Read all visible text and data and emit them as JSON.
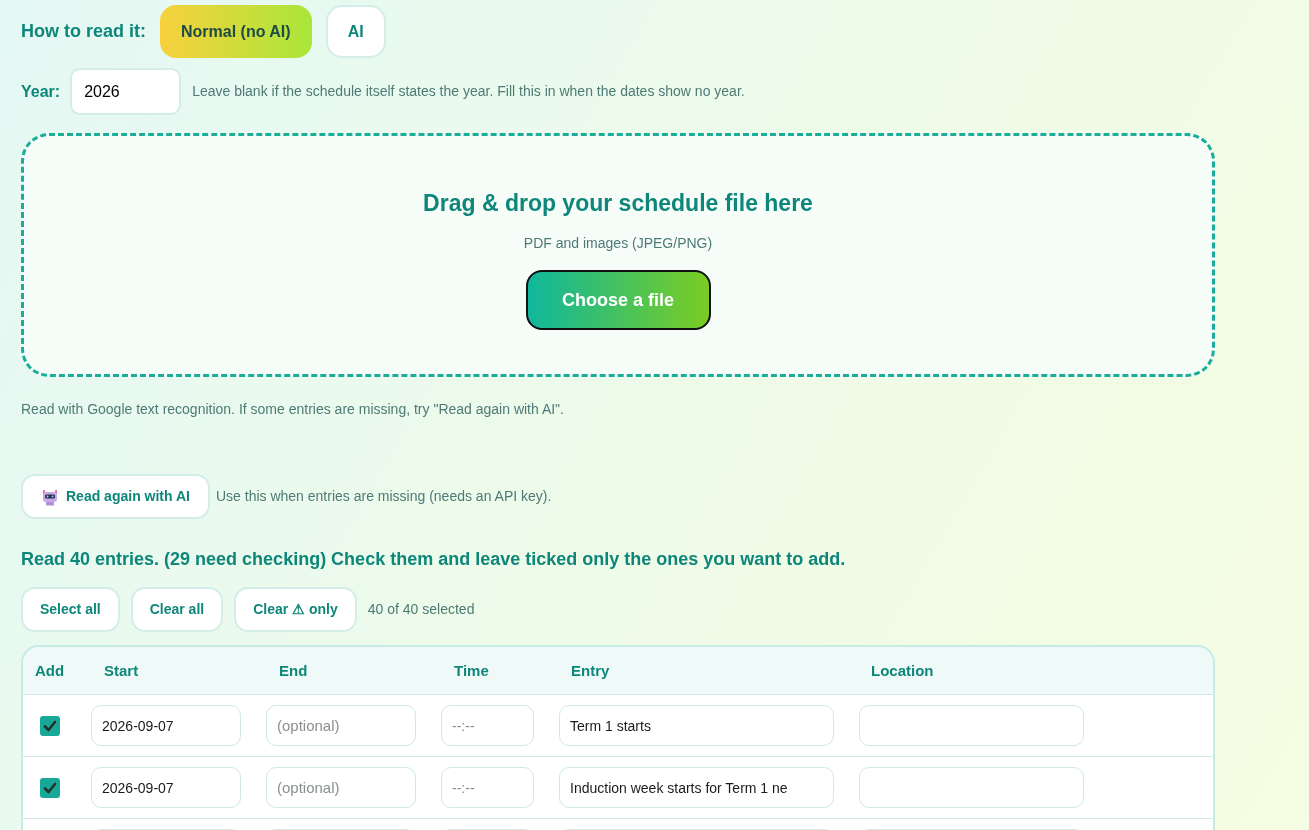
{
  "read_mode": {
    "label": "How to read it:",
    "options": [
      {
        "label": "Normal (no AI)",
        "selected": true
      },
      {
        "label": "AI",
        "selected": false
      }
    ]
  },
  "year": {
    "label": "Year:",
    "value": "2026",
    "hint": "Leave blank if the schedule itself states the year. Fill this in when the dates show no year."
  },
  "drop_zone": {
    "title": "Drag & drop your schedule file here",
    "subtitle": "PDF and images (JPEG/PNG)",
    "button": "Choose a file"
  },
  "read_note": "Read with Google text recognition. If some entries are missing, try \"Read again with AI\".",
  "ai_retry": {
    "button": "Read again with AI",
    "hint": "Use this when entries are missing (needs an API key)."
  },
  "results": {
    "heading": "Read 40 entries. (29 need checking) Check them and leave ticked only the ones you want to add.",
    "actions": [
      "Select all",
      "Clear all",
      "Clear ⚠ only"
    ],
    "selection_count": "40 of 40 selected"
  },
  "table": {
    "columns": [
      "Add",
      "Start",
      "End",
      "Time",
      "Entry",
      "Location"
    ],
    "rows": [
      {
        "checked": true,
        "start": "2026-09-07",
        "end_placeholder": "(optional)",
        "time_placeholder": "--:--",
        "entry": "Term 1 starts"
      },
      {
        "checked": true,
        "start": "2026-09-07",
        "end_placeholder": "(optional)",
        "time_placeholder": "--:--",
        "entry": "Induction week starts for Term 1 ne"
      },
      {}
    ]
  }
}
